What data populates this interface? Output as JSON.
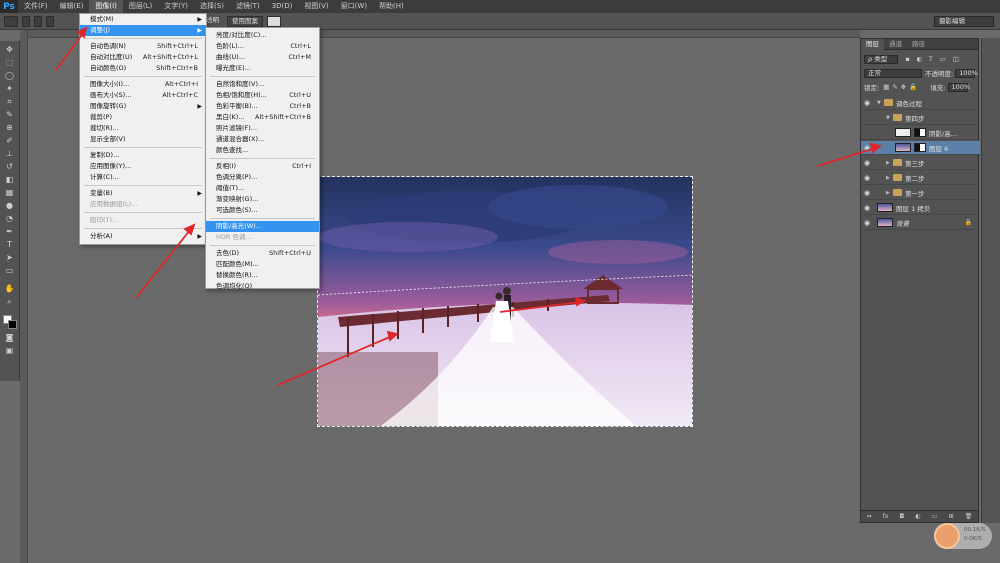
{
  "app": {
    "logo": "Ps"
  },
  "menubar": {
    "items": [
      "文件(F)",
      "编辑(E)",
      "图像(I)",
      "图层(L)",
      "文字(Y)",
      "选择(S)",
      "滤镜(T)",
      "3D(D)",
      "视图(V)",
      "窗口(W)",
      "帮助(H)"
    ],
    "active_index": 2
  },
  "options": {
    "transparent_label": "透明",
    "use_pattern_label": "使用图案",
    "workspace": "摄影编辑"
  },
  "image_menu": {
    "items": [
      {
        "label": "模式(M)",
        "shortcut": "",
        "submenu": true,
        "disabled": false
      },
      {
        "label": "调整(J)",
        "shortcut": "",
        "submenu": true,
        "disabled": false,
        "highlighted": true
      },
      {
        "label": "自动色调(N)",
        "shortcut": "Shift+Ctrl+L"
      },
      {
        "label": "自动对比度(U)",
        "shortcut": "Alt+Shift+Ctrl+L"
      },
      {
        "label": "自动颜色(O)",
        "shortcut": "Shift+Ctrl+B"
      },
      {
        "label": "图像大小(I)...",
        "shortcut": "Alt+Ctrl+I"
      },
      {
        "label": "画布大小(S)...",
        "shortcut": "Alt+Ctrl+C"
      },
      {
        "label": "图像旋转(G)",
        "shortcut": "",
        "submenu": true
      },
      {
        "label": "裁剪(P)",
        "shortcut": ""
      },
      {
        "label": "裁切(R)...",
        "shortcut": ""
      },
      {
        "label": "显示全部(V)",
        "shortcut": ""
      },
      {
        "label": "复制(D)...",
        "shortcut": ""
      },
      {
        "label": "应用图像(Y)...",
        "shortcut": ""
      },
      {
        "label": "计算(C)...",
        "shortcut": ""
      },
      {
        "label": "变量(B)",
        "shortcut": "",
        "submenu": true
      },
      {
        "label": "应用数据组(L)...",
        "shortcut": "",
        "disabled": true
      },
      {
        "label": "陷印(T)...",
        "shortcut": "",
        "disabled": true
      },
      {
        "label": "分析(A)",
        "shortcut": "",
        "submenu": true
      }
    ]
  },
  "adjust_menu": {
    "items": [
      {
        "label": "亮度/对比度(C)...",
        "shortcut": ""
      },
      {
        "label": "色阶(L)...",
        "shortcut": "Ctrl+L"
      },
      {
        "label": "曲线(U)...",
        "shortcut": "Ctrl+M"
      },
      {
        "label": "曝光度(E)...",
        "shortcut": ""
      },
      {
        "label": "自然饱和度(V)...",
        "shortcut": ""
      },
      {
        "label": "色相/饱和度(H)...",
        "shortcut": "Ctrl+U"
      },
      {
        "label": "色彩平衡(B)...",
        "shortcut": "Ctrl+B"
      },
      {
        "label": "黑白(K)...",
        "shortcut": "Alt+Shift+Ctrl+B"
      },
      {
        "label": "照片滤镜(F)...",
        "shortcut": ""
      },
      {
        "label": "通道混合器(X)...",
        "shortcut": ""
      },
      {
        "label": "颜色查找...",
        "shortcut": ""
      },
      {
        "label": "反相(I)",
        "shortcut": "Ctrl+I"
      },
      {
        "label": "色调分离(P)...",
        "shortcut": ""
      },
      {
        "label": "阈值(T)...",
        "shortcut": ""
      },
      {
        "label": "渐变映射(G)...",
        "shortcut": ""
      },
      {
        "label": "可选颜色(S)...",
        "shortcut": ""
      },
      {
        "label": "阴影/高光(W)...",
        "shortcut": "",
        "highlighted": true
      },
      {
        "label": "HDR 色调...",
        "shortcut": "",
        "disabled": true
      },
      {
        "label": "去色(D)",
        "shortcut": "Shift+Ctrl+U"
      },
      {
        "label": "匹配颜色(M)...",
        "shortcut": ""
      },
      {
        "label": "替换颜色(R)...",
        "shortcut": ""
      },
      {
        "label": "色调均化(Q)",
        "shortcut": ""
      }
    ]
  },
  "layers_panel": {
    "tabs": [
      "图层",
      "通道",
      "路径"
    ],
    "filter_label": "ρ 类型",
    "blend_mode": "正常",
    "opacity_label": "不透明度:",
    "opacity_value": "100%",
    "lock_label": "锁定:",
    "fill_label": "填充:",
    "fill_value": "100%",
    "layers": [
      {
        "name": "调色过程",
        "kind": "group",
        "indent": 0,
        "expanded": true,
        "visible": true
      },
      {
        "name": "第四步",
        "kind": "group",
        "indent": 1,
        "expanded": true,
        "visible": false
      },
      {
        "name": "阴影/高...",
        "kind": "adjust",
        "indent": 2,
        "visible": false
      },
      {
        "name": "图层 6",
        "kind": "pixel",
        "indent": 2,
        "visible": true,
        "selected": true
      },
      {
        "name": "第三步",
        "kind": "group",
        "indent": 1,
        "visible": true
      },
      {
        "name": "第二步",
        "kind": "group",
        "indent": 1,
        "visible": true
      },
      {
        "name": "第一步",
        "kind": "group",
        "indent": 1,
        "visible": true
      },
      {
        "name": "图层 1 拷贝",
        "kind": "pixel",
        "indent": 0,
        "visible": true
      },
      {
        "name": "背景",
        "kind": "pixel",
        "indent": 0,
        "visible": true,
        "locked": true
      }
    ],
    "bottom_icons": [
      "link-icon",
      "fx-icon",
      "mask-icon",
      "adjustment-icon",
      "folder-icon",
      "new-layer-icon",
      "trash-icon"
    ],
    "bottom_labels": [
      "⇔",
      "fx",
      "◘",
      "◐",
      "▭",
      "⊞",
      "🗑"
    ]
  },
  "watermark": {
    "line1": "00.1K/S",
    "line2": "0.0K/S"
  }
}
